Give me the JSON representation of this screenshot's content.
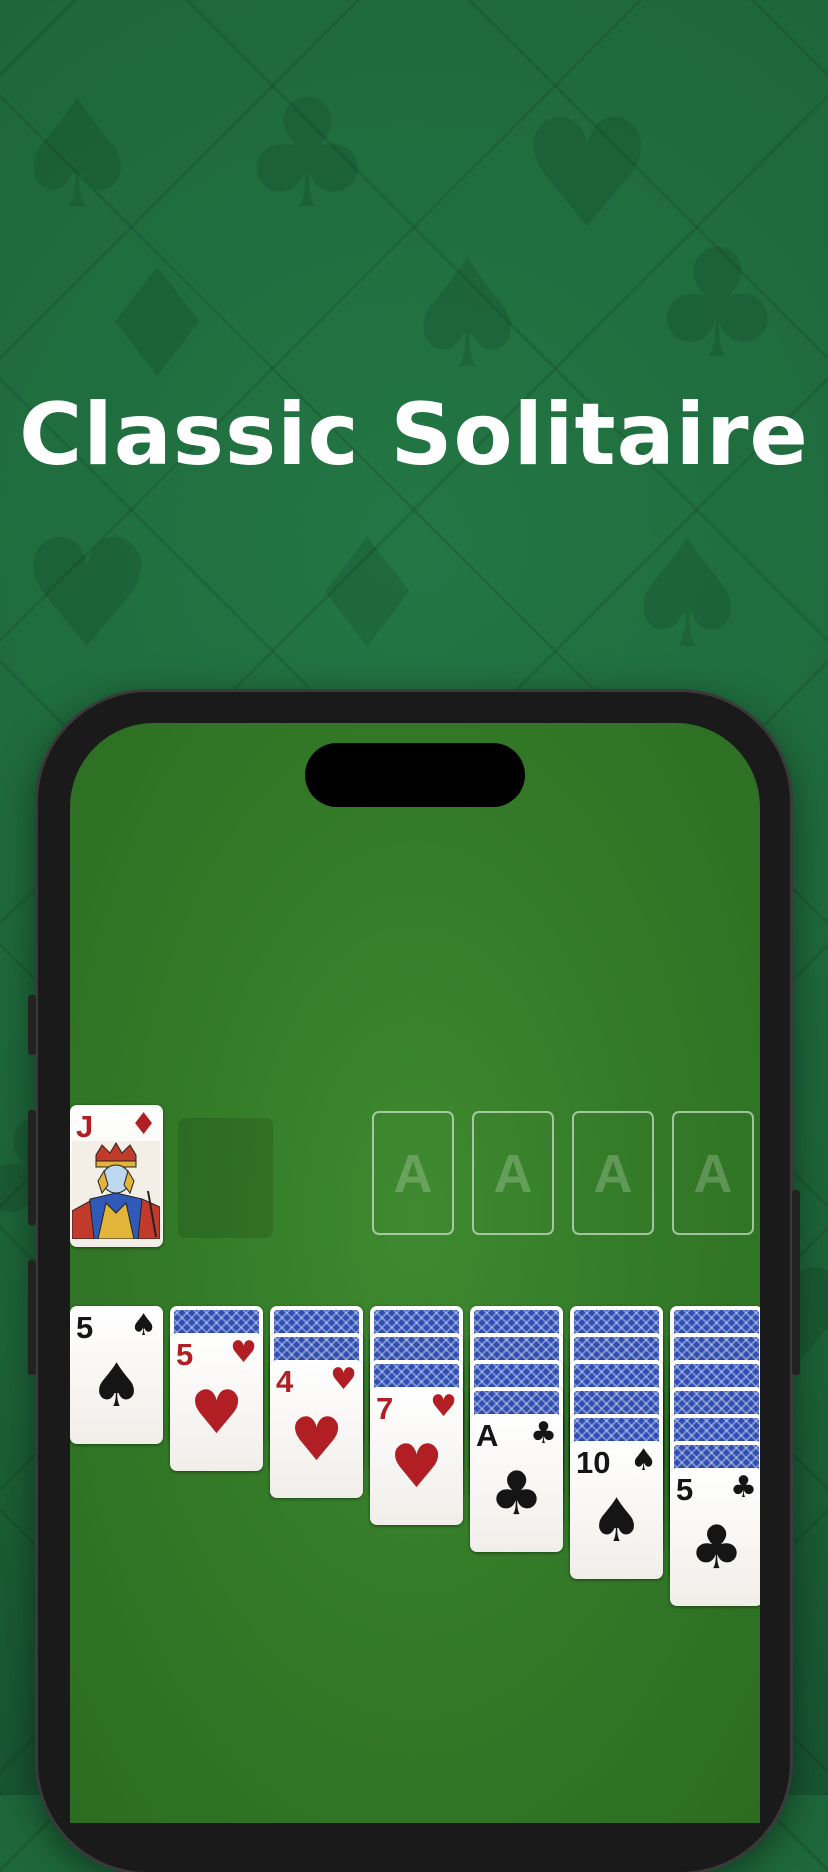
{
  "headline": "Classic Solitaire",
  "colors": {
    "felt": "#347b28",
    "background": "#1f6a3c",
    "red_suit": "#b11e24",
    "black_suit": "#151515",
    "card_back": "#2f4fb4"
  },
  "waste_card": {
    "rank": "J",
    "suit": "♦",
    "color": "red"
  },
  "foundations": [
    "A",
    "A",
    "A",
    "A"
  ],
  "tableau": [
    {
      "hidden": 0,
      "rank": "5",
      "suit": "♠",
      "color": "black"
    },
    {
      "hidden": 1,
      "rank": "5",
      "suit": "♥",
      "color": "red"
    },
    {
      "hidden": 2,
      "rank": "4",
      "suit": "♥",
      "color": "red"
    },
    {
      "hidden": 3,
      "rank": "7",
      "suit": "♥",
      "color": "red"
    },
    {
      "hidden": 4,
      "rank": "A",
      "suit": "♣",
      "color": "black"
    },
    {
      "hidden": 5,
      "rank": "10",
      "suit": "♠",
      "color": "black"
    },
    {
      "hidden": 6,
      "rank": "5",
      "suit": "♣",
      "color": "black"
    }
  ]
}
